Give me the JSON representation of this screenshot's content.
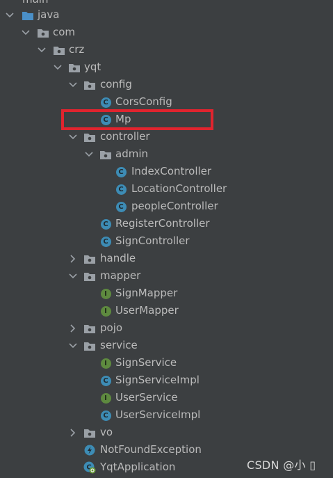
{
  "tree": {
    "nodes": [
      {
        "label": "main",
        "kind": "folder-src",
        "expanded": true
      },
      {
        "label": "java",
        "kind": "folder-src",
        "expanded": true
      },
      {
        "label": "com",
        "kind": "package",
        "expanded": true
      },
      {
        "label": "crz",
        "kind": "package",
        "expanded": true
      },
      {
        "label": "yqt",
        "kind": "package",
        "expanded": true
      },
      {
        "label": "config",
        "kind": "package",
        "expanded": true
      },
      {
        "label": "CorsConfig",
        "kind": "class"
      },
      {
        "label": "Mp",
        "kind": "class",
        "highlighted": true
      },
      {
        "label": "controller",
        "kind": "package",
        "expanded": true
      },
      {
        "label": "admin",
        "kind": "package",
        "expanded": true
      },
      {
        "label": "IndexController",
        "kind": "class"
      },
      {
        "label": "LocationController",
        "kind": "class"
      },
      {
        "label": "peopleController",
        "kind": "class"
      },
      {
        "label": "RegisterController",
        "kind": "class"
      },
      {
        "label": "SignController",
        "kind": "class"
      },
      {
        "label": "handle",
        "kind": "package",
        "expanded": false
      },
      {
        "label": "mapper",
        "kind": "package",
        "expanded": true
      },
      {
        "label": "SignMapper",
        "kind": "interface"
      },
      {
        "label": "UserMapper",
        "kind": "interface"
      },
      {
        "label": "pojo",
        "kind": "package",
        "expanded": false
      },
      {
        "label": "service",
        "kind": "package",
        "expanded": true
      },
      {
        "label": "SignService",
        "kind": "interface"
      },
      {
        "label": "SignServiceImpl",
        "kind": "class"
      },
      {
        "label": "UserService",
        "kind": "interface"
      },
      {
        "label": "UserServiceImpl",
        "kind": "class"
      },
      {
        "label": "vo",
        "kind": "package",
        "expanded": false
      },
      {
        "label": "NotFoundException",
        "kind": "exception"
      },
      {
        "label": "YqtApplication",
        "kind": "spring-app"
      }
    ]
  },
  "icons": {
    "class_badge": "C",
    "interface_badge": "I"
  },
  "colors": {
    "background": "#3c3f41",
    "text": "#bbbbbb",
    "class_icon": "#3d8cb5",
    "interface_icon": "#5e8a3f",
    "highlight_border": "#e0242e"
  },
  "watermark": "CSDN @小 ▯"
}
